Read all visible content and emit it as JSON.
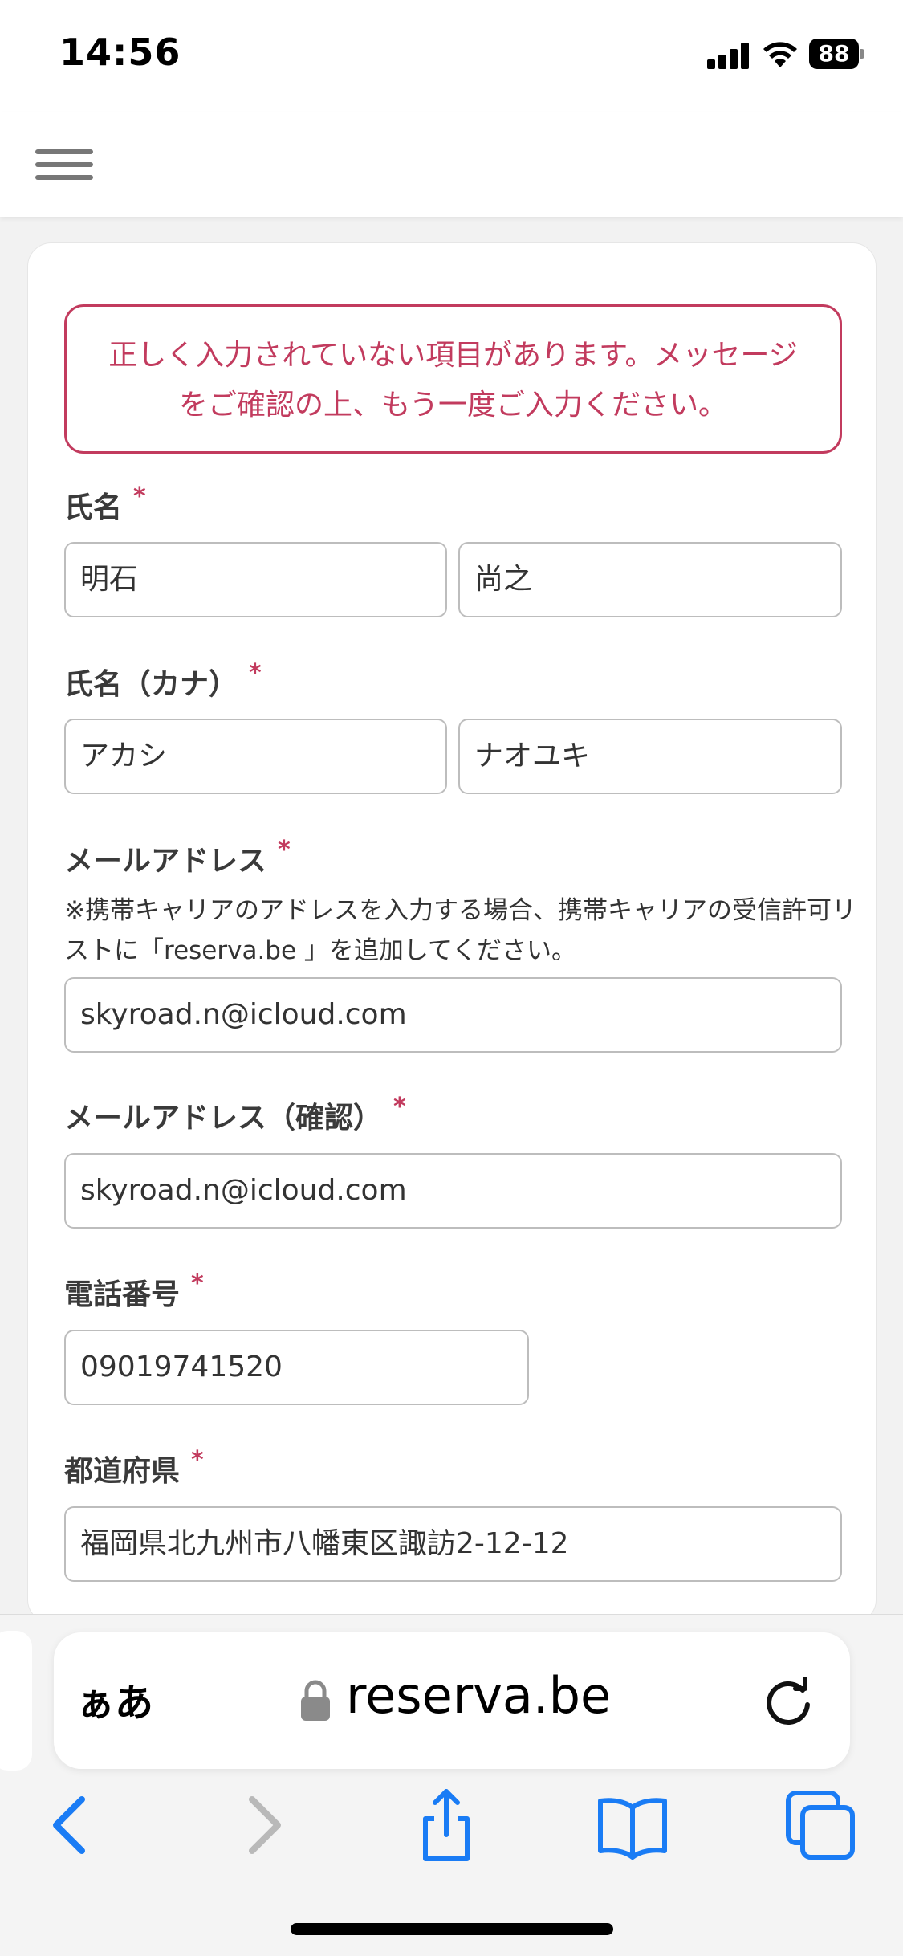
{
  "status_bar": {
    "time": "14:56",
    "battery": "88"
  },
  "error_message": "正しく入力されていない項目があります。メッセージをご確認の上、もう一度ご入力ください。",
  "required_mark": "*",
  "fields": {
    "name": {
      "label": "氏名",
      "last": "明石",
      "first": "尚之"
    },
    "name_kana": {
      "label": "氏名（カナ）",
      "last": "アカシ",
      "first": "ナオユキ"
    },
    "email": {
      "label": "メールアドレス",
      "note": "※携帯キャリアのアドレスを入力する場合、携帯キャリアの受信許可リストに「reserva.be 」を追加してください。",
      "value": "skyroad.n@icloud.com"
    },
    "email_confirm": {
      "label": "メールアドレス（確認）",
      "value": "skyroad.n@icloud.com"
    },
    "phone": {
      "label": "電話番号",
      "value": "09019741520"
    },
    "prefecture": {
      "label": "都道府県",
      "value": "福岡県北九州市八幡東区諏訪2-12-12"
    }
  },
  "browser": {
    "aa_label": "ぁあ",
    "url": "reserva.be"
  },
  "colors": {
    "accent": "#c23b5e",
    "ios_blue": "#1a7cf5"
  }
}
